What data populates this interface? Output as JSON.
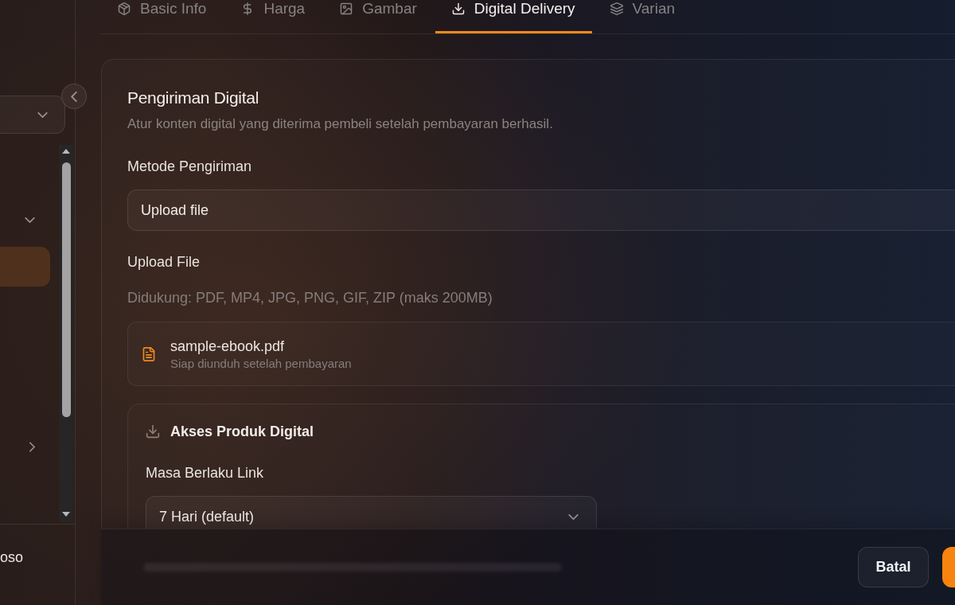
{
  "sidebar": {
    "items": [
      {
        "kind": "group",
        "expanded": true,
        "selected": false
      },
      {
        "kind": "link",
        "selected": true
      },
      {
        "kind": "group",
        "expanded": false,
        "selected": false
      }
    ],
    "user_name": "oso"
  },
  "tabs": [
    {
      "label": "Basic Info",
      "selected": false
    },
    {
      "label": "Harga",
      "selected": false
    },
    {
      "label": "Gambar",
      "selected": false
    },
    {
      "label": "Digital Delivery",
      "selected": true
    },
    {
      "label": "Varian",
      "selected": false
    }
  ],
  "delivery": {
    "title": "Pengiriman Digital",
    "subtitle": "Atur konten digital yang diterima pembeli setelah pembayaran berhasil.",
    "method": {
      "label": "Metode Pengiriman",
      "value": "Upload file"
    },
    "upload": {
      "label": "Upload File",
      "hint": "Didukung: PDF, MP4, JPG, PNG, GIF, ZIP (maks 200MB)",
      "files": [
        {
          "name": "sample-ebook.pdf",
          "status": "Siap diunduh setelah pembayaran"
        }
      ]
    },
    "access": {
      "title": "Akses Produk Digital",
      "link_expiry": {
        "label": "Masa Berlaku Link",
        "value": "7 Hari (default)"
      }
    }
  },
  "footer": {
    "buttons": [
      {
        "kind": "secondary",
        "label": "Batal"
      },
      {
        "kind": "primary"
      }
    ]
  }
}
